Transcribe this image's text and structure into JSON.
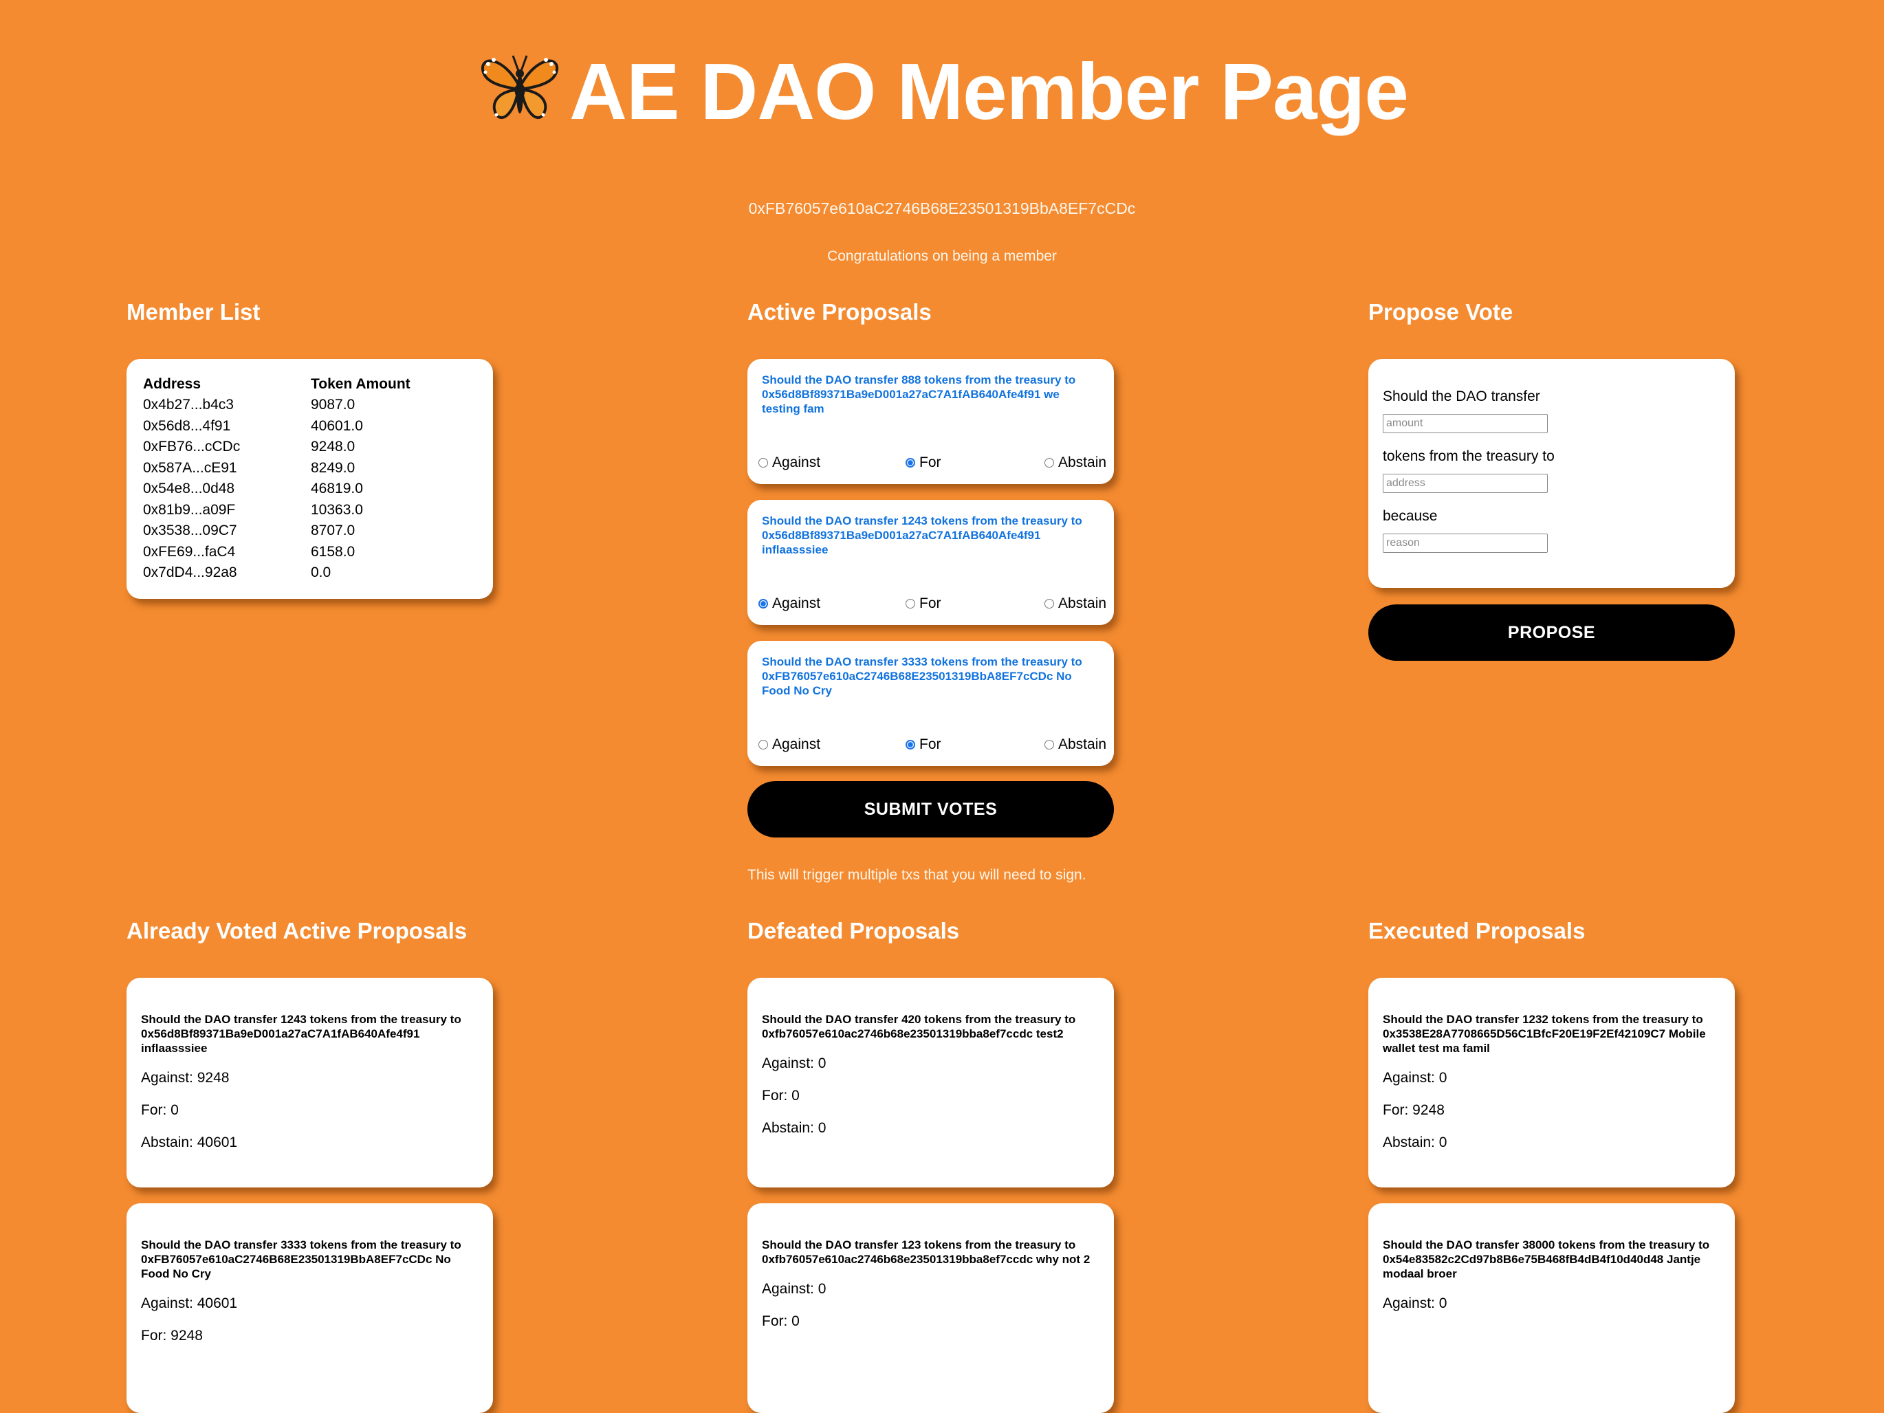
{
  "header": {
    "title": "AE DAO Member Page",
    "logo_icon": "butterfly-icon",
    "wallet_address": "0xFB76057e610aC2746B68E23501319BbA8EF7cCDc",
    "congrats": "Congratulations on being a member"
  },
  "colors": {
    "background": "#f48b30",
    "proposal_text": "#1273de",
    "button": "#000000"
  },
  "member_list": {
    "title": "Member List",
    "columns": [
      "Address",
      "Token Amount"
    ],
    "rows": [
      [
        "0x4b27...b4c3",
        "9087.0"
      ],
      [
        "0x56d8...4f91",
        "40601.0"
      ],
      [
        "0xFB76...cCDc",
        "9248.0"
      ],
      [
        "0x587A...cE91",
        "8249.0"
      ],
      [
        "0x54e8...0d48",
        "46819.0"
      ],
      [
        "0x81b9...a09F",
        "10363.0"
      ],
      [
        "0x3538...09C7",
        "8707.0"
      ],
      [
        "0xFE69...faC4",
        "6158.0"
      ],
      [
        "0x7dD4...92a8",
        "0.0"
      ]
    ]
  },
  "active_proposals": {
    "title": "Active Proposals",
    "options": [
      "Against",
      "For",
      "Abstain"
    ],
    "items": [
      {
        "text": "Should the DAO transfer 888 tokens from the treasury to 0x56d8Bf89371Ba9eD001a27aC7A1fAB640Afe4f91 we testing fam",
        "selected": "For"
      },
      {
        "text": "Should the DAO transfer 1243 tokens from the treasury to 0x56d8Bf89371Ba9eD001a27aC7A1fAB640Afe4f91 inflaasssiee",
        "selected": "Against"
      },
      {
        "text": "Should the DAO transfer 3333 tokens from the treasury to 0xFB76057e610aC2746B68E23501319BbA8EF7cCDc No Food No Cry",
        "selected": "For"
      }
    ],
    "submit_label": "SUBMIT VOTES",
    "note": "This will trigger multiple txs that you will need to sign."
  },
  "propose_vote": {
    "title": "Propose Vote",
    "label1": "Should the DAO transfer",
    "amount_placeholder": "amount",
    "label2": "tokens from the treasury to",
    "address_placeholder": "address",
    "label3": "because",
    "reason_placeholder": "reason",
    "button_label": "PROPOSE"
  },
  "already_voted": {
    "title": "Already Voted Active Proposals",
    "items": [
      {
        "text": "Should the DAO transfer 1243 tokens from the treasury to 0x56d8Bf89371Ba9eD001a27aC7A1fAB640Afe4f91 inflaasssiee",
        "against": "Against: 9248",
        "for": "For: 0",
        "abstain": "Abstain: 40601"
      },
      {
        "text": "Should the DAO transfer 3333 tokens from the treasury to 0xFB76057e610aC2746B68E23501319BbA8EF7cCDc No Food No Cry",
        "against": "Against: 40601",
        "for": "For: 9248",
        "abstain": ""
      }
    ]
  },
  "defeated": {
    "title": "Defeated Proposals",
    "items": [
      {
        "text": "Should the DAO transfer 420 tokens from the treasury to 0xfb76057e610ac2746b68e23501319bba8ef7ccdc test2",
        "against": "Against: 0",
        "for": "For: 0",
        "abstain": "Abstain: 0"
      },
      {
        "text": "Should the DAO transfer 123 tokens from the treasury to 0xfb76057e610ac2746b68e23501319bba8ef7ccdc why not 2",
        "against": "Against: 0",
        "for": "For: 0",
        "abstain": ""
      }
    ]
  },
  "executed": {
    "title": "Executed Proposals",
    "items": [
      {
        "text": "Should the DAO transfer 1232 tokens from the treasury to 0x3538E28A7708665D56C1BfcF20E19F2Ef42109C7 Mobile wallet test ma famil",
        "against": "Against: 0",
        "for": "For: 9248",
        "abstain": "Abstain: 0"
      },
      {
        "text": "Should the DAO transfer 38000 tokens from the treasury to 0x54e83582c2Cd97b8B6e75B468fB4dB4f10d40d48 Jantje modaal broer",
        "against": "Against: 0",
        "for": "",
        "abstain": ""
      }
    ]
  }
}
